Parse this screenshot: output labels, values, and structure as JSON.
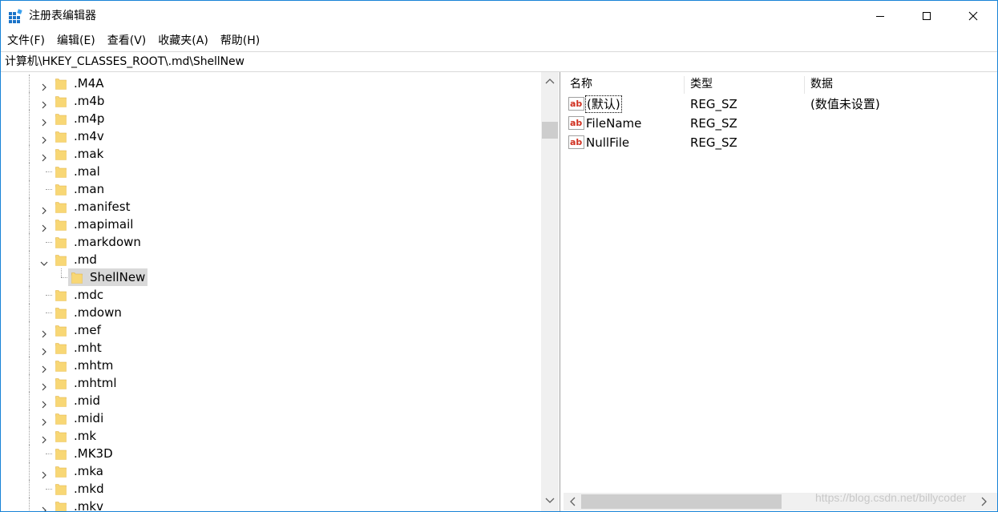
{
  "window": {
    "title": "注册表编辑器",
    "controls": {
      "minimize": "minimize",
      "maximize": "maximize",
      "close": "close"
    }
  },
  "menu": [
    "文件(F)",
    "编辑(E)",
    "查看(V)",
    "收藏夹(A)",
    "帮助(H)"
  ],
  "address": "计算机\\HKEY_CLASSES_ROOT\\.md\\ShellNew",
  "tree": {
    "items": [
      {
        "label": ".M4A",
        "expander": "collapsed"
      },
      {
        "label": ".m4b",
        "expander": "collapsed"
      },
      {
        "label": ".m4p",
        "expander": "collapsed"
      },
      {
        "label": ".m4v",
        "expander": "collapsed"
      },
      {
        "label": ".mak",
        "expander": "collapsed"
      },
      {
        "label": ".mal",
        "expander": "none"
      },
      {
        "label": ".man",
        "expander": "none"
      },
      {
        "label": ".manifest",
        "expander": "collapsed"
      },
      {
        "label": ".mapimail",
        "expander": "collapsed"
      },
      {
        "label": ".markdown",
        "expander": "none"
      },
      {
        "label": ".md",
        "expander": "expanded"
      },
      {
        "label": "ShellNew",
        "expander": "child",
        "selected": true
      },
      {
        "label": ".mdc",
        "expander": "none"
      },
      {
        "label": ".mdown",
        "expander": "none"
      },
      {
        "label": ".mef",
        "expander": "collapsed"
      },
      {
        "label": ".mht",
        "expander": "collapsed"
      },
      {
        "label": ".mhtm",
        "expander": "collapsed"
      },
      {
        "label": ".mhtml",
        "expander": "collapsed"
      },
      {
        "label": ".mid",
        "expander": "collapsed"
      },
      {
        "label": ".midi",
        "expander": "collapsed"
      },
      {
        "label": ".mk",
        "expander": "collapsed"
      },
      {
        "label": ".MK3D",
        "expander": "none"
      },
      {
        "label": ".mka",
        "expander": "collapsed"
      },
      {
        "label": ".mkd",
        "expander": "none"
      },
      {
        "label": ".mkv",
        "expander": "collapsed"
      }
    ]
  },
  "list": {
    "columns": [
      "名称",
      "类型",
      "数据"
    ],
    "rows": [
      {
        "name": "(默认)",
        "type": "REG_SZ",
        "data": "(数值未设置)",
        "focused": true
      },
      {
        "name": "FileName",
        "type": "REG_SZ",
        "data": ""
      },
      {
        "name": "NullFile",
        "type": "REG_SZ",
        "data": ""
      }
    ]
  },
  "watermark": "https://blog.csdn.net/billycoder",
  "colors": {
    "window_border": "#1883d7",
    "selection": "#d9d9d9",
    "folder": "#f8d775",
    "scrollbar_track": "#f0f0f0",
    "scrollbar_thumb": "#cdcdcd"
  }
}
